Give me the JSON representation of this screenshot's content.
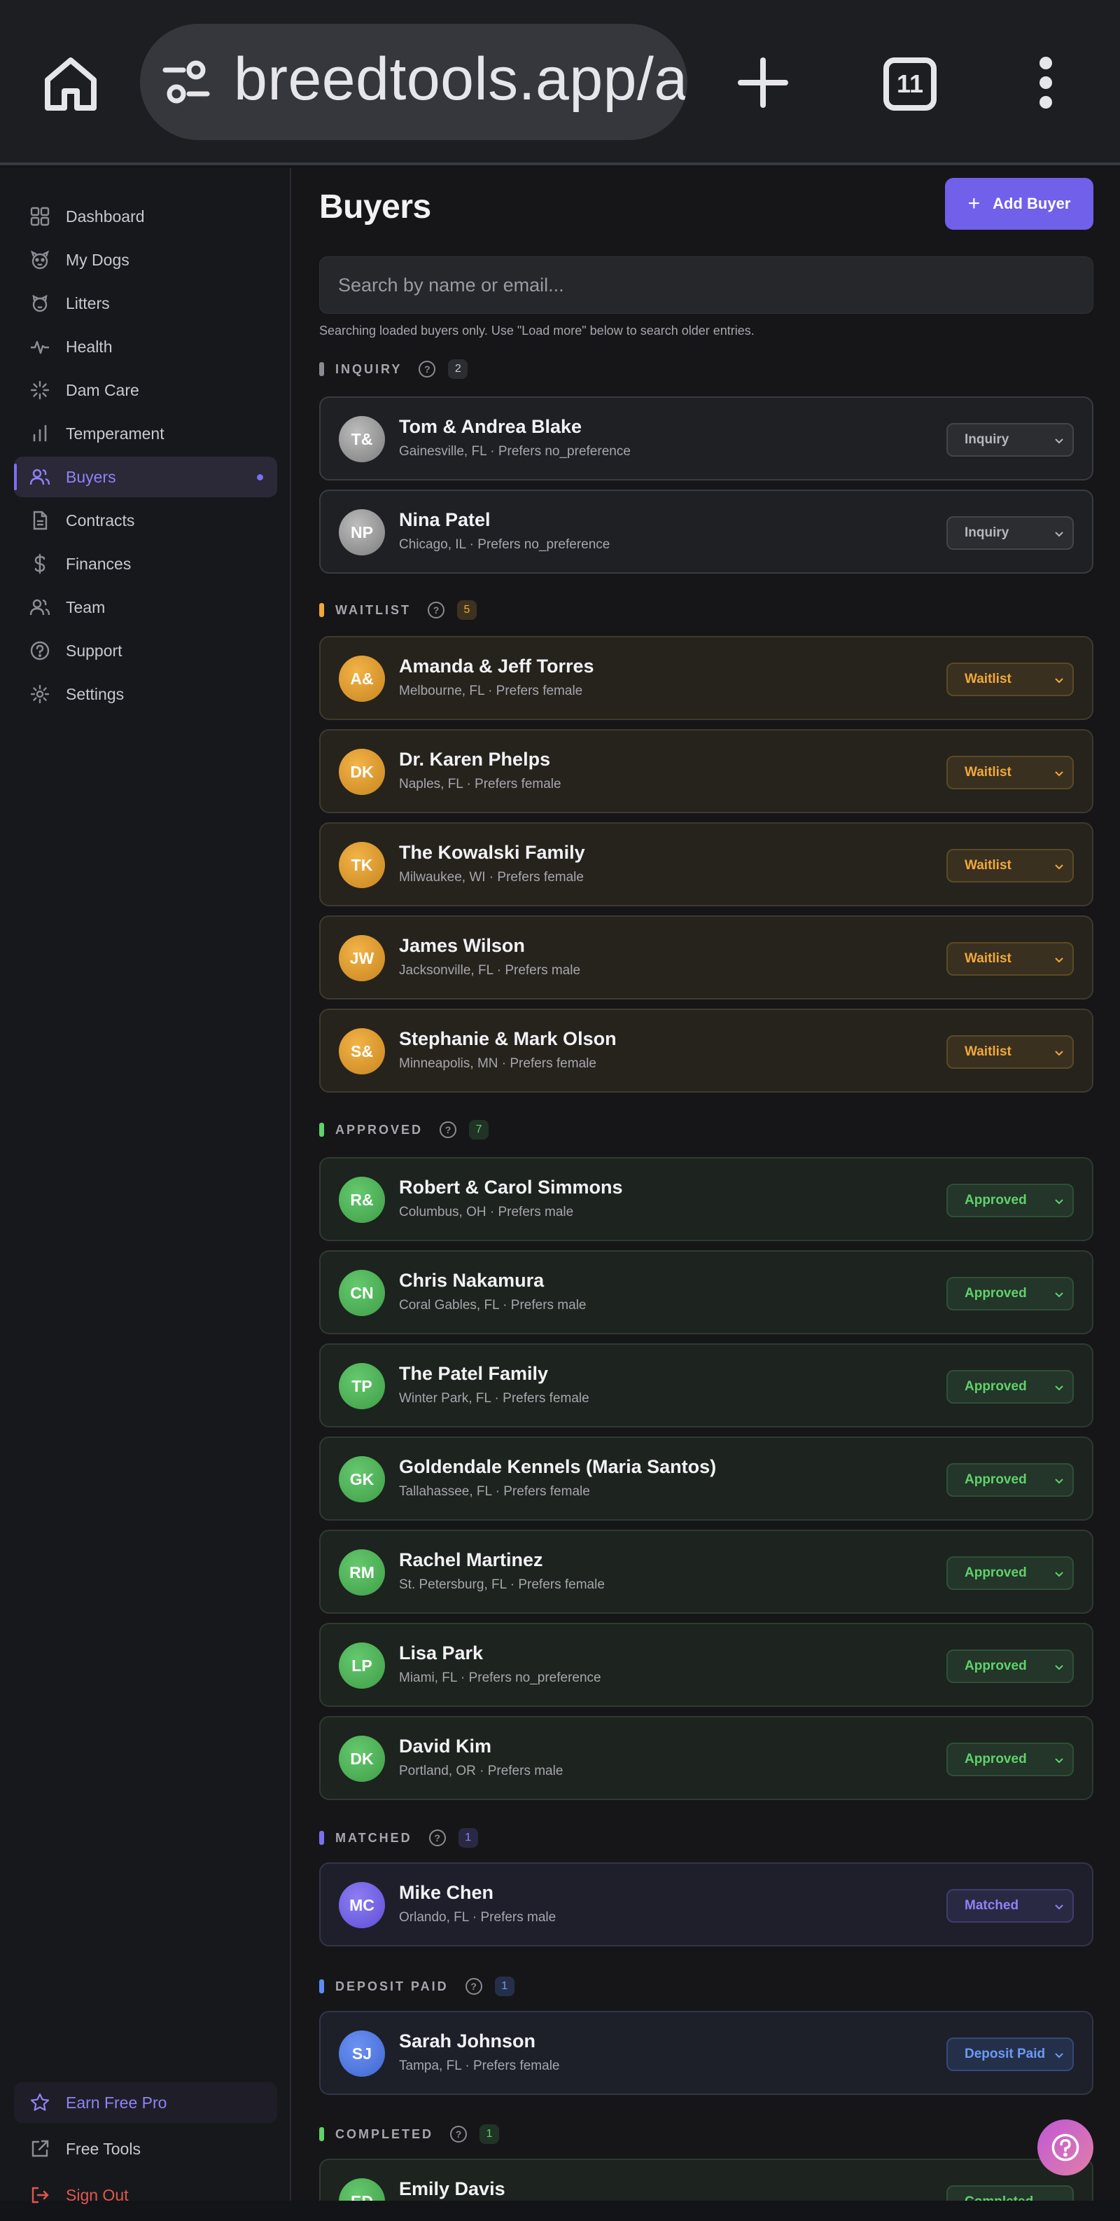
{
  "browser": {
    "url": "breedtools.app/a",
    "tab_count": "11"
  },
  "sidebar": {
    "items": [
      {
        "label": "Dashboard",
        "icon": "grid-icon"
      },
      {
        "label": "My Dogs",
        "icon": "paw-icon"
      },
      {
        "label": "Litters",
        "icon": "litter-icon"
      },
      {
        "label": "Health",
        "icon": "pulse-icon"
      },
      {
        "label": "Dam Care",
        "icon": "spark-icon"
      },
      {
        "label": "Temperament",
        "icon": "bar-chart-icon"
      },
      {
        "label": "Buyers",
        "icon": "users-icon"
      },
      {
        "label": "Contracts",
        "icon": "document-icon"
      },
      {
        "label": "Finances",
        "icon": "dollar-icon"
      },
      {
        "label": "Team",
        "icon": "team-icon"
      },
      {
        "label": "Support",
        "icon": "help-circle-icon"
      },
      {
        "label": "Settings",
        "icon": "gear-icon"
      }
    ],
    "bottom": {
      "earn": "Earn Free Pro",
      "free_tools": "Free Tools",
      "sign_out": "Sign Out"
    }
  },
  "main": {
    "title": "Buyers",
    "add_button": "Add Buyer",
    "search_placeholder": "Search by name or email...",
    "search_hint": "Searching loaded buyers only. Use \"Load more\" below to search older entries."
  },
  "sections": [
    {
      "label": "INQUIRY",
      "count": "2",
      "status": "Inquiry",
      "buyers": [
        {
          "initials": "T&",
          "name": "Tom & Andrea Blake",
          "sub": "Gainesville, FL · Prefers no_preference"
        },
        {
          "initials": "NP",
          "name": "Nina Patel",
          "sub": "Chicago, IL · Prefers no_preference"
        }
      ]
    },
    {
      "label": "WAITLIST",
      "count": "5",
      "status": "Waitlist",
      "buyers": [
        {
          "initials": "A&",
          "name": "Amanda & Jeff Torres",
          "sub": "Melbourne, FL · Prefers female"
        },
        {
          "initials": "DK",
          "name": "Dr. Karen Phelps",
          "sub": "Naples, FL · Prefers female"
        },
        {
          "initials": "TK",
          "name": "The Kowalski Family",
          "sub": "Milwaukee, WI · Prefers female"
        },
        {
          "initials": "JW",
          "name": "James Wilson",
          "sub": "Jacksonville, FL · Prefers male"
        },
        {
          "initials": "S&",
          "name": "Stephanie & Mark Olson",
          "sub": "Minneapolis, MN · Prefers female"
        }
      ]
    },
    {
      "label": "APPROVED",
      "count": "7",
      "status": "Approved",
      "buyers": [
        {
          "initials": "R&",
          "name": "Robert & Carol Simmons",
          "sub": "Columbus, OH · Prefers male"
        },
        {
          "initials": "CN",
          "name": "Chris Nakamura",
          "sub": "Coral Gables, FL · Prefers male"
        },
        {
          "initials": "TP",
          "name": "The Patel Family",
          "sub": "Winter Park, FL · Prefers female"
        },
        {
          "initials": "GK",
          "name": "Goldendale Kennels (Maria Santos)",
          "sub": "Tallahassee, FL · Prefers female"
        },
        {
          "initials": "RM",
          "name": "Rachel Martinez",
          "sub": "St. Petersburg, FL · Prefers female"
        },
        {
          "initials": "LP",
          "name": "Lisa Park",
          "sub": "Miami, FL · Prefers no_preference"
        },
        {
          "initials": "DK",
          "name": "David Kim",
          "sub": "Portland, OR · Prefers male"
        }
      ]
    },
    {
      "label": "MATCHED",
      "count": "1",
      "status": "Matched",
      "buyers": [
        {
          "initials": "MC",
          "name": "Mike Chen",
          "sub": "Orlando, FL · Prefers male"
        }
      ]
    },
    {
      "label": "DEPOSIT PAID",
      "count": "1",
      "status": "Deposit Paid",
      "buyers": [
        {
          "initials": "SJ",
          "name": "Sarah Johnson",
          "sub": "Tampa, FL · Prefers female"
        }
      ]
    },
    {
      "label": "COMPLETED",
      "count": "1",
      "status": "Completed",
      "buyers": [
        {
          "initials": "ED",
          "name": "Emily Davis",
          "sub": ""
        }
      ]
    }
  ],
  "colors": {
    "accent": "#7160ea",
    "inquiry": "#8a8a93",
    "waitlist": "#f0a83a",
    "approved": "#5fd26a",
    "matched": "#8e83f5",
    "deposit_paid": "#6c9bf5",
    "completed": "#5fd26a"
  }
}
